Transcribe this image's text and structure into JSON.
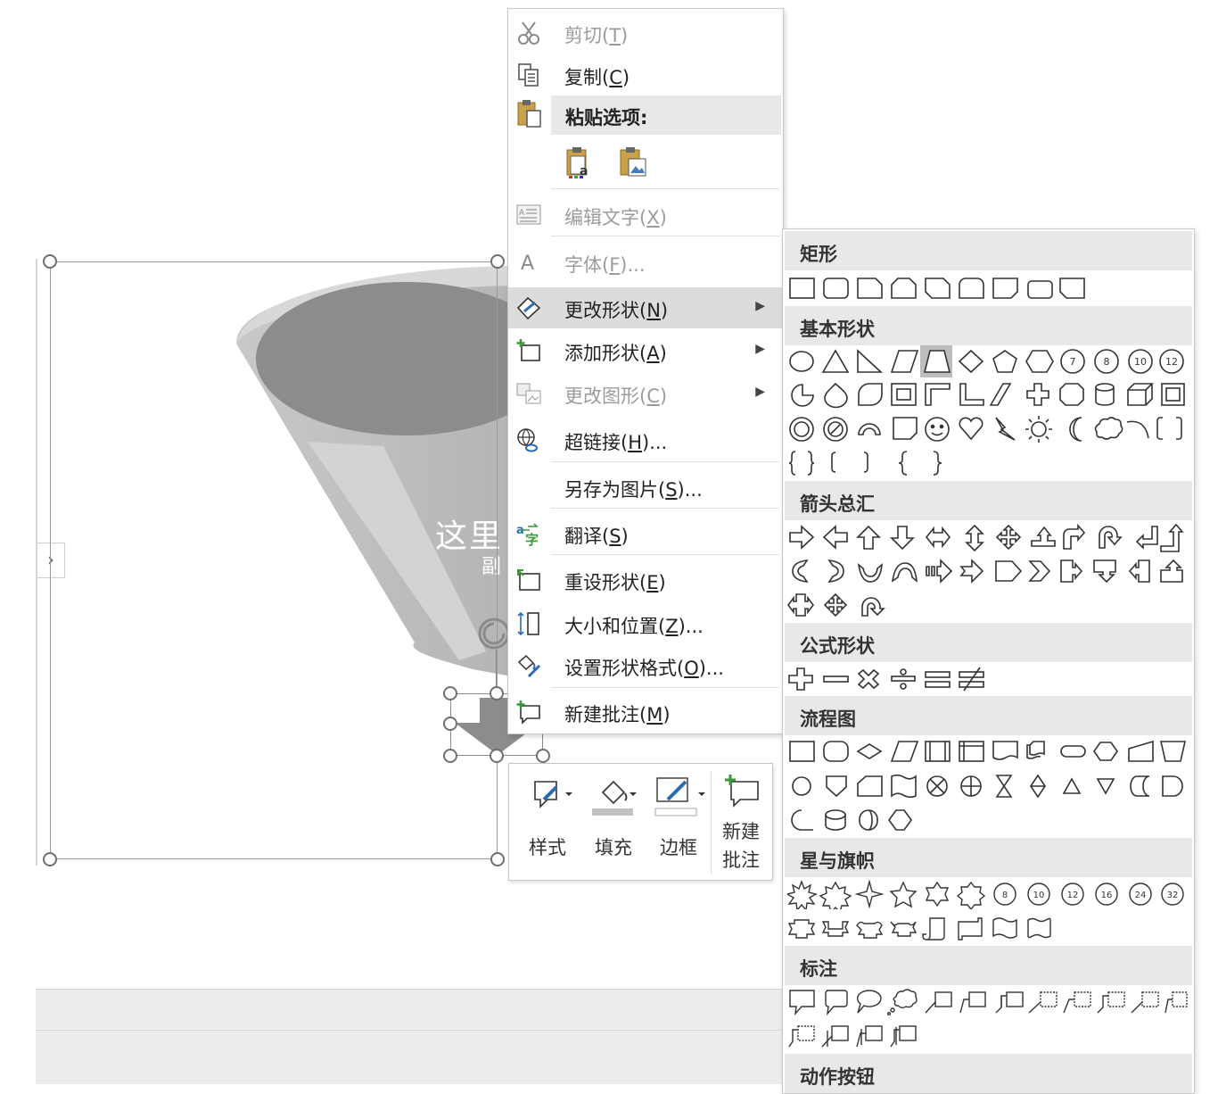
{
  "slide": {
    "funnel_title": "这里",
    "funnel_subtitle": "副",
    "collapse_glyph": "›"
  },
  "context_menu": {
    "items": [
      {
        "id": "cut",
        "label": "剪切(T)",
        "mnemonic": "T",
        "icon": "scissors-icon",
        "enabled": false
      },
      {
        "id": "copy",
        "label": "复制(C)",
        "mnemonic": "C",
        "icon": "copy-icon",
        "enabled": true
      },
      {
        "id": "edit-text",
        "label": "编辑文字(X)",
        "mnemonic": "X",
        "icon": "edit-text-icon",
        "enabled": false
      },
      {
        "id": "font",
        "label": "字体(F)...",
        "mnemonic": "F",
        "icon": "font-icon",
        "enabled": false
      },
      {
        "id": "change-shape",
        "label": "更改形状(N)",
        "mnemonic": "N",
        "icon": "change-shape-icon",
        "enabled": true,
        "highlighted": true,
        "submenu": true
      },
      {
        "id": "add-shape",
        "label": "添加形状(A)",
        "mnemonic": "A",
        "icon": "add-shape-icon",
        "enabled": true,
        "submenu": true
      },
      {
        "id": "change-graphic",
        "label": "更改图形(C)",
        "mnemonic": "C",
        "icon": "change-graphic-icon",
        "enabled": false,
        "submenu": true
      },
      {
        "id": "hyperlink",
        "label": "超链接(H)...",
        "mnemonic": "H",
        "icon": "hyperlink-icon",
        "enabled": true
      },
      {
        "id": "save-as-picture",
        "label": "另存为图片(S)...",
        "mnemonic": "S",
        "icon": "",
        "enabled": true
      },
      {
        "id": "translate",
        "label": "翻译(S)",
        "mnemonic": "S",
        "icon": "translate-icon",
        "enabled": true
      },
      {
        "id": "reset-shape",
        "label": "重设形状(E)",
        "mnemonic": "E",
        "icon": "reset-shape-icon",
        "enabled": true
      },
      {
        "id": "size-position",
        "label": "大小和位置(Z)...",
        "mnemonic": "Z",
        "icon": "size-position-icon",
        "enabled": true
      },
      {
        "id": "format-shape",
        "label": "设置形状格式(O)...",
        "mnemonic": "O",
        "icon": "format-shape-icon",
        "enabled": true
      },
      {
        "id": "new-comment",
        "label": "新建批注(M)",
        "mnemonic": "M",
        "icon": "new-comment-icon",
        "enabled": true
      }
    ],
    "paste_header": "粘贴选项:",
    "paste_options": [
      "paste-keep-text-icon",
      "paste-picture-icon"
    ]
  },
  "mini_toolbar": {
    "style_label": "样式",
    "fill_label": "填充",
    "border_label": "边框",
    "comment_label_1": "新建",
    "comment_label_2": "批注"
  },
  "shape_gallery": {
    "categories": [
      {
        "id": "rectangles",
        "label": "矩形",
        "rows": [
          9
        ]
      },
      {
        "id": "basic",
        "label": "基本形状",
        "rows": [
          12,
          12,
          12,
          5
        ],
        "selected_index": 4
      },
      {
        "id": "arrows",
        "label": "箭头总汇",
        "rows": [
          12,
          12,
          3
        ]
      },
      {
        "id": "equation",
        "label": "公式形状",
        "rows": [
          6
        ]
      },
      {
        "id": "flowchart",
        "label": "流程图",
        "rows": [
          12,
          12,
          4
        ]
      },
      {
        "id": "stars",
        "label": "星与旗帜",
        "rows": [
          12,
          8
        ]
      },
      {
        "id": "callouts",
        "label": "标注",
        "rows": [
          12,
          4
        ]
      },
      {
        "id": "action-buttons",
        "label": "动作按钮",
        "rows": []
      }
    ],
    "badges": {
      "basic_numbers": [
        "7",
        "8",
        "10",
        "12"
      ],
      "star_numbers": [
        "8",
        "10",
        "12",
        "16",
        "24",
        "32"
      ]
    }
  }
}
